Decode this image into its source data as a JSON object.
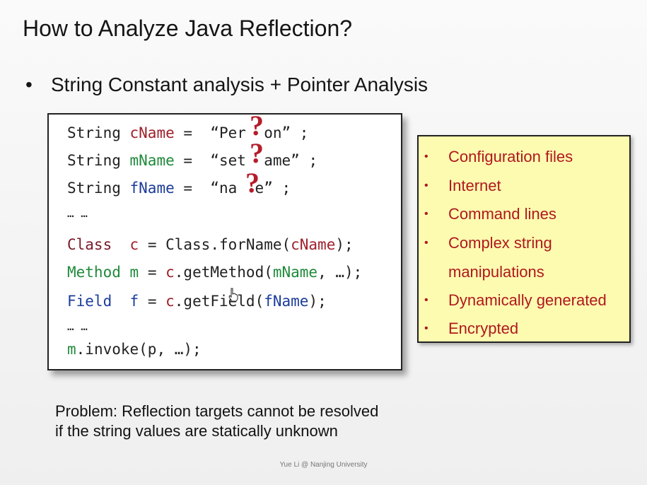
{
  "title": "How to Analyze Java Reflection?",
  "bullet": "String Constant analysis + Pointer Analysis",
  "code": {
    "line1": {
      "type": "String",
      "var": "cName",
      "eq": "=",
      "str": "“Per  on”",
      "end": ";"
    },
    "line2": {
      "type": "String",
      "var": "mName",
      "eq": "=",
      "str": "“set  ame”",
      "end": ";"
    },
    "line3": {
      "type": "String",
      "var": "fName",
      "eq": "=",
      "str": "“na  e”",
      "end": ";"
    },
    "ellipsis1": "… …",
    "line5": {
      "type": "Class",
      "var": "c",
      "rhs": "= Class.forName(",
      "arg": "cName",
      "close": ");"
    },
    "line6": {
      "type": "Method",
      "var": "m",
      "rhs1": "= ",
      "obj": "c",
      "rhs2": ".getMethod(",
      "arg": "mName",
      "close": ", …);"
    },
    "line7": {
      "type": "Field",
      "var": "f",
      "rhs1": "= ",
      "obj": "c",
      "rhs2": ".getField(",
      "arg": "fName",
      "close": ");"
    },
    "ellipsis2": "… …",
    "line9": {
      "obj": "m",
      "rest": ".invoke(p, …);"
    },
    "question_mark": "?"
  },
  "sources": {
    "bullet": "•",
    "items": [
      "Configuration files",
      "Internet",
      "Command lines",
      "Complex string",
      "manipulations",
      "Dynamically generated",
      "Encrypted"
    ]
  },
  "problem": {
    "line1": "Problem: Reflection targets cannot be resolved",
    "line2": "if the string values are statically unknown"
  },
  "footer": "Yue Li @ Nanjing University",
  "bullet_glyph": "•",
  "colors": {
    "accent_red": "#b0181e",
    "source_bg": "#fdfbb0"
  }
}
